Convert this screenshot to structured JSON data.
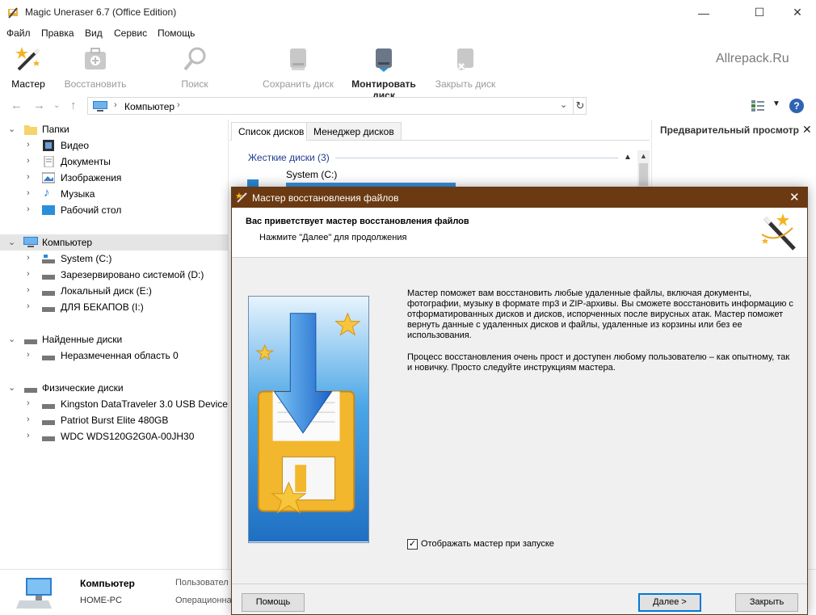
{
  "window": {
    "title": "Magic Uneraser 6.7 (Office Edition)"
  },
  "menu": [
    "Файл",
    "Правка",
    "Вид",
    "Сервис",
    "Помощь"
  ],
  "toolbar": {
    "master": "Мастер",
    "restore": "Восстановить",
    "search": "Поиск",
    "save_disk": "Сохранить диск",
    "mount_disk": "Монтировать диск",
    "close_disk": "Закрыть диск"
  },
  "watermark": "Allrepack.Ru",
  "address": {
    "crumb": "Компьютер"
  },
  "tree": {
    "folders": "Папки",
    "video": "Видео",
    "documents": "Документы",
    "images": "Изображения",
    "music": "Музыка",
    "desktop": "Рабочий стол",
    "computer": "Компьютер",
    "system_c": "System (C:)",
    "reserved_d": "Зарезервировано системой (D:)",
    "local_e": "Локальный диск (E:)",
    "backups_i": "ДЛЯ БЕКАПОВ (I:)",
    "found": "Найденные диски",
    "unalloc": "Неразмеченная область 0",
    "physical": "Физические диски",
    "kingston": "Kingston DataTraveler 3.0 USB Device",
    "patriot": "Patriot Burst Elite 480GB",
    "wdc": "WDC WDS120G2G0A-00JH30"
  },
  "center": {
    "tab_list": "Список дисков",
    "tab_manager": "Менеджер дисков",
    "group": "Жесткие диски (3)",
    "disk_c": "System (C:)"
  },
  "preview": {
    "title": "Предварительный просмотр"
  },
  "status": {
    "name": "Компьютер",
    "host": "HOME-PC",
    "key1": "Пользовател",
    "key2": "Операционна"
  },
  "dialog": {
    "title": "Мастер восстановления файлов",
    "heading": "Вас приветствует мастер восстановления файлов",
    "subheading": "Нажмите \"Далее\" для продолжения",
    "p1": "Мастер поможет вам восстановить любые удаленные файлы, включая документы, фотографии, музыку в формате mp3 и ZIP-архивы. Вы сможете восстановить информацию с отформатированных дисков и дисков, испорченных после вирусных атак. Мастер поможет вернуть данные с удаленных дисков и файлы, удаленные из корзины или без ее использования.",
    "p2": "Процесс восстановления очень прост и доступен любому пользователю – как опытному, так и новичку. Просто следуйте инструкциям мастера.",
    "checkbox": "Отображать мастер при запуске",
    "checked": true,
    "btn_help": "Помощь",
    "btn_next": "Далее >",
    "btn_close": "Закрыть"
  },
  "colors": {
    "dialog_title": "#6b3a12",
    "accent": "#0078d7",
    "group_header": "#1e3d8f"
  }
}
